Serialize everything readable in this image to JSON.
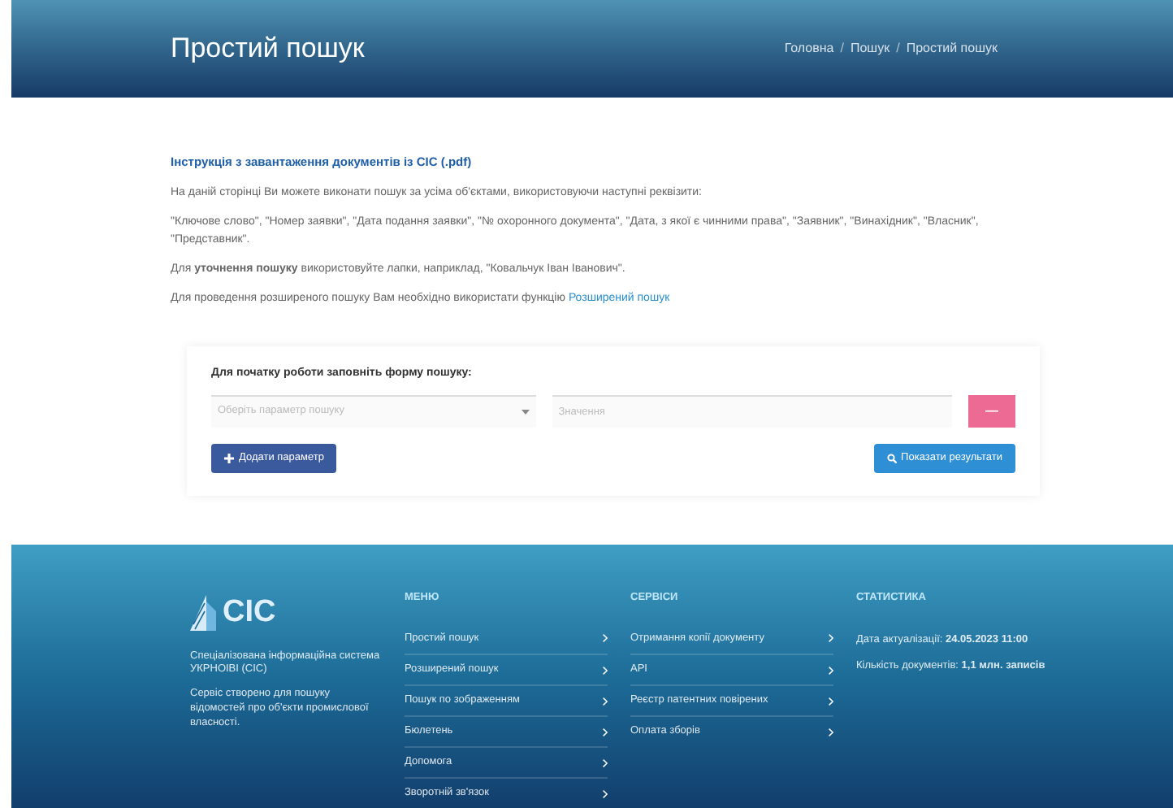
{
  "header": {
    "title": "Простий пошук",
    "breadcrumbs": [
      {
        "label": "Головна"
      },
      {
        "separator": "/",
        "label": "Пошук"
      },
      {
        "separator": "/",
        "label": "Простий пошук"
      }
    ]
  },
  "intro": {
    "instruction_link": "Інструкція з завантаження документів із СІС (.pdf)",
    "paragraphs": [
      "На даній сторінці Ви можете виконати пошук за усіма об'єктами, використовуючи наступні реквізити:",
      "\"Ключове слово\", \"Номер заявки\", \"Дата подання заявки\", \"№ охоронного документа\", \"Дата, з якої є чинними права\", \"Заявник\", \"Винахідник\", \"Власник\", \"Представник\".",
      "Для **уточнення пошуку** використовуйте лапки, наприклад, \"Ковальчук Іван Іванович\"."
    ],
    "advanced_text": "Для проведення розширеного пошуку Вам необхідно використати функцію",
    "advanced_link": "Розширений пошук"
  },
  "form": {
    "label": "Для початку роботи заповніть форму пошуку:",
    "select_placeholder": "Оберіть параметр пошуку",
    "value_placeholder": "Значення",
    "remove_button": "—",
    "add_button": "Додати параметр",
    "submit_button": "Показати результати"
  },
  "footer": {
    "logo": "СІС",
    "about": [
      "Спеціалізована інформаційна система УКРНОІВІ (СІС)",
      "Сервіс створено для пошуку відомостей про об'єкти промислової власності."
    ],
    "columns": [
      {
        "title": "МЕНЮ",
        "items": [
          "Простий пошук",
          "Розширений пошук",
          "Пошук по зображенням",
          "Бюлетень",
          "Допомога",
          "Зворотній зв'язок"
        ]
      },
      {
        "title": "СЕРВІСИ",
        "items": [
          "Отримання копії документу",
          "API",
          "Реєстр патентних повірених",
          "Оплата зборів"
        ]
      }
    ],
    "stats_title": "СТАТИСТИКА",
    "stats": [
      {
        "label": "Дата актуалізації:",
        "value": "24.05.2023 11:00"
      },
      {
        "label": "Кількість документів:",
        "value": "1,1 млн. записів"
      }
    ]
  }
}
